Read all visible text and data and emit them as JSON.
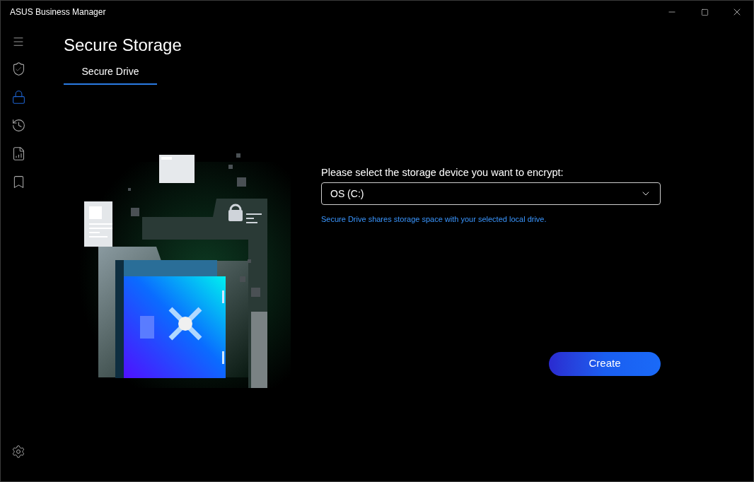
{
  "window": {
    "title": "ASUS Business Manager"
  },
  "sidebar": {
    "items": [
      {
        "kind": "shield",
        "selected": false
      },
      {
        "kind": "lock",
        "selected": true
      },
      {
        "kind": "history",
        "selected": false
      },
      {
        "kind": "file",
        "selected": false
      },
      {
        "kind": "bookmark",
        "selected": false
      }
    ]
  },
  "page": {
    "title": "Secure Storage"
  },
  "tabs": [
    {
      "label": "Secure Drive",
      "selected": true
    }
  ],
  "form": {
    "label": "Please select the storage device you want to encrypt:",
    "value": "OS (C:)",
    "hint": "Secure Drive shares storage space with your selected local drive."
  },
  "buttons": [
    {
      "label": "Create"
    }
  ]
}
